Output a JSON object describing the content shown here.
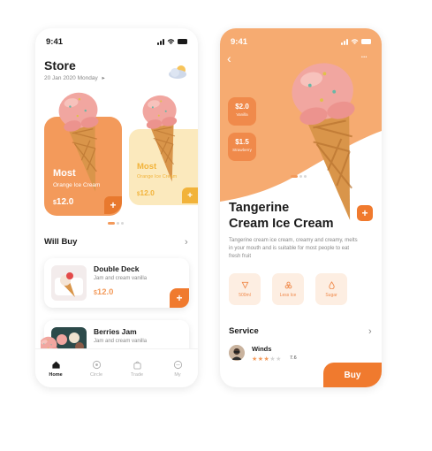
{
  "left": {
    "status_time": "9:41",
    "title": "Store",
    "date": "20 Jan 2020 Monday",
    "date_arrow": "▸",
    "weather_icon": "cloud-sun-icon",
    "featured": [
      {
        "title": "Most",
        "subtitle": "Orange Ice Cream",
        "currency": "$",
        "price": "12.0",
        "plus": "+"
      },
      {
        "title": "Most",
        "subtitle": "Orange Ice Cream",
        "currency": "$",
        "price": "12.0",
        "plus": "+"
      }
    ],
    "will_buy_title": "Will Buy",
    "will_buy_chevron": "›",
    "items": [
      {
        "name": "Double Deck",
        "desc": "Jam and cream vanilla",
        "currency": "$",
        "price": "12.0",
        "plus": "+"
      },
      {
        "name": "Berries Jam",
        "desc": "Jam and cream vanilla"
      }
    ],
    "tabs": [
      {
        "label": "Home",
        "icon": "home-icon",
        "active": true
      },
      {
        "label": "Circle",
        "icon": "circle-icon",
        "active": false
      },
      {
        "label": "Trade",
        "icon": "bag-icon",
        "active": false
      },
      {
        "label": "My",
        "icon": "chat-icon",
        "active": false
      }
    ]
  },
  "right": {
    "status_time": "9:41",
    "back": "‹",
    "more": "•••",
    "badges": [
      {
        "price": "$2.0",
        "label": "Vanilla"
      },
      {
        "price": "$1.5",
        "label": "Strawberry"
      }
    ],
    "product_title_line1": "Tangerine",
    "product_title_line2": "Cream Ice Cream",
    "add": "+",
    "description": "Tangerine cream ice cream, creamy and creamy, melts in your mouth and is suitable for most people to eat fresh fruit",
    "features": [
      {
        "label": "500ml",
        "icon": "cup-icon"
      },
      {
        "label": "Less Ice",
        "icon": "ice-icon"
      },
      {
        "label": "Sugar",
        "icon": "drop-icon"
      }
    ],
    "service_title": "Service",
    "service_chevron": "›",
    "reviewer": "Winds",
    "rating_value": 3.5,
    "rating_text": "7.6",
    "buy_label": "Buy"
  },
  "colors": {
    "orange": "#f39a5b",
    "deep_orange": "#f07a2e",
    "yellow_card": "#fbe9bd",
    "yellow_text": "#f2b33a",
    "hero": "#f6ab71"
  }
}
